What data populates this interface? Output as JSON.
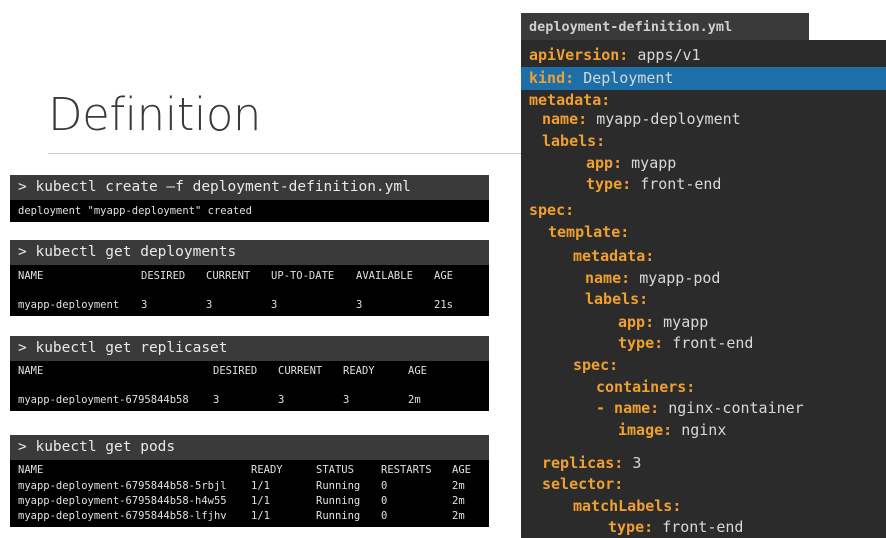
{
  "slide": {
    "title": "Definition"
  },
  "terminals": [
    {
      "command": "> kubectl create –f deployment-definition.yml",
      "output": "deployment \"myapp-deployment\" created"
    },
    {
      "command": "> kubectl get deployments",
      "headers": [
        "NAME",
        "DESIRED",
        "CURRENT",
        "UP-TO-DATE",
        "AVAILABLE",
        "AGE"
      ],
      "rows": [
        [
          "myapp-deployment",
          "3",
          "3",
          "3",
          "3",
          "21s"
        ]
      ]
    },
    {
      "command": "> kubectl get replicaset",
      "headers": [
        "NAME",
        "DESIRED",
        "CURRENT",
        "READY",
        "AGE"
      ],
      "rows": [
        [
          "myapp-deployment-6795844b58",
          "3",
          "3",
          "3",
          "2m"
        ]
      ]
    },
    {
      "command": "> kubectl get pods",
      "headers": [
        "NAME",
        "READY",
        "STATUS",
        "RESTARTS",
        "AGE"
      ],
      "rows": [
        [
          "myapp-deployment-6795844b58-5rbjl",
          "1/1",
          "Running",
          "0",
          "2m"
        ],
        [
          "myapp-deployment-6795844b58-h4w55",
          "1/1",
          "Running",
          "0",
          "2m"
        ],
        [
          "myapp-deployment-6795844b58-lfjhv",
          "1/1",
          "Running",
          "0",
          "2m"
        ]
      ]
    }
  ],
  "yaml": {
    "filename": "deployment-definition.yml",
    "highlighted_line": 1,
    "lines": [
      {
        "key": "apiVersion:",
        "value": "apps/v1"
      },
      {
        "key": "kind:",
        "value": "Deployment"
      },
      {
        "key": "metadata:",
        "value": ""
      },
      {
        "key": "name:",
        "value": "myapp-deployment"
      },
      {
        "key": "labels:",
        "value": ""
      },
      {
        "key": "app:",
        "value": "myapp"
      },
      {
        "key": "type:",
        "value": "front-end"
      },
      {
        "key": "spec:",
        "value": ""
      },
      {
        "key": "template:",
        "value": ""
      },
      {
        "key": "metadata:",
        "value": ""
      },
      {
        "key": "name:",
        "value": "myapp-pod"
      },
      {
        "key": "labels:",
        "value": ""
      },
      {
        "key": "app:",
        "value": "myapp"
      },
      {
        "key": "type:",
        "value": "front-end"
      },
      {
        "key": "spec:",
        "value": ""
      },
      {
        "key": "containers:",
        "value": ""
      },
      {
        "key": "- name:",
        "value": "nginx-container"
      },
      {
        "key": "image:",
        "value": "nginx"
      },
      {
        "key": "replicas:",
        "value": "3"
      },
      {
        "key": "selector:",
        "value": ""
      },
      {
        "key": "matchLabels:",
        "value": ""
      },
      {
        "key": "type:",
        "value": "front-end"
      }
    ]
  },
  "colors": {
    "yaml_key": "#f0a030",
    "yaml_value": "#d8d8d8",
    "highlight": "#1c6fa8",
    "terminal_header": "#3a3a3a",
    "terminal_body": "#000000"
  }
}
